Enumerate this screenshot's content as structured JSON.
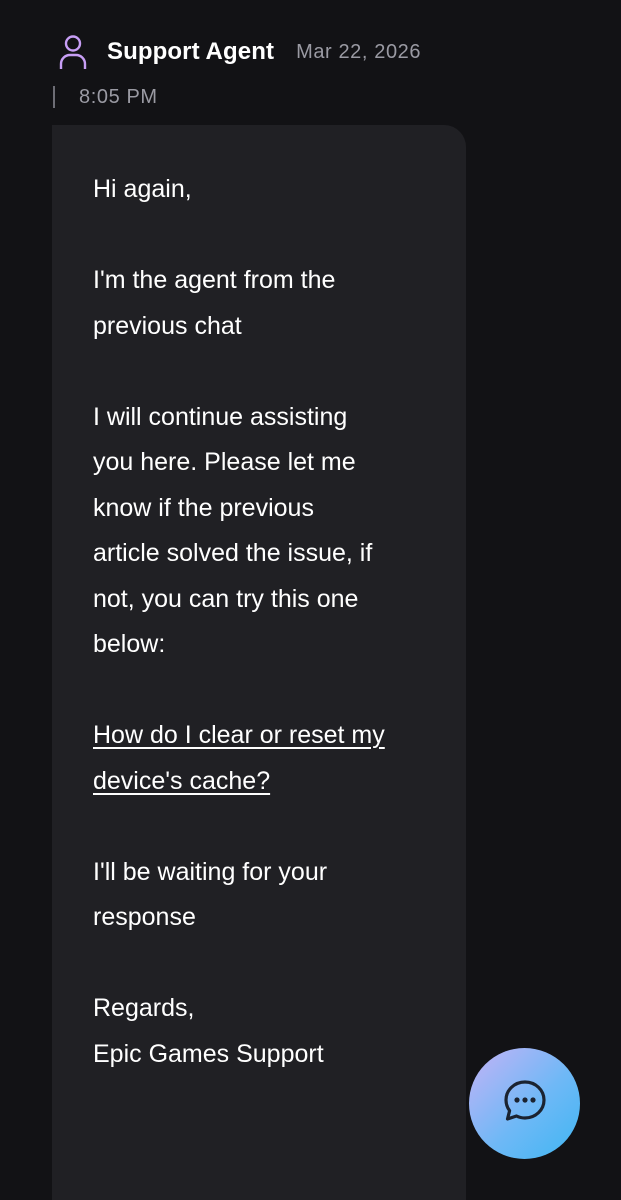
{
  "message": {
    "sender": "Support Agent",
    "date": "Mar 22, 2026",
    "time": "8:05 PM",
    "icons": {
      "avatar": "person-icon",
      "chat_button": "chat-bubble-icon"
    },
    "colors": {
      "avatar": "#c79ef5",
      "bubble": "#202024",
      "background": "#121215",
      "fab_gradient_start": "#c5b3f6",
      "fab_gradient_end": "#3fb6f3"
    },
    "body": {
      "greeting": "Hi again,",
      "intro_line1": "I'm the agent from the",
      "intro_line2": "previous chat",
      "para_line1": "I will continue assisting",
      "para_line2": "you here. Please let me",
      "para_line3": "know if the previous",
      "para_line4": "article solved the issue, if",
      "para_line5": "not, you can try this one",
      "para_line6": "below:",
      "link_line1": "How do I clear or reset my",
      "link_line2": "device's cache?",
      "wait_line1": "I'll be waiting for your",
      "wait_line2": "response",
      "closing": "Regards,",
      "signature": "Epic Games Support"
    }
  }
}
